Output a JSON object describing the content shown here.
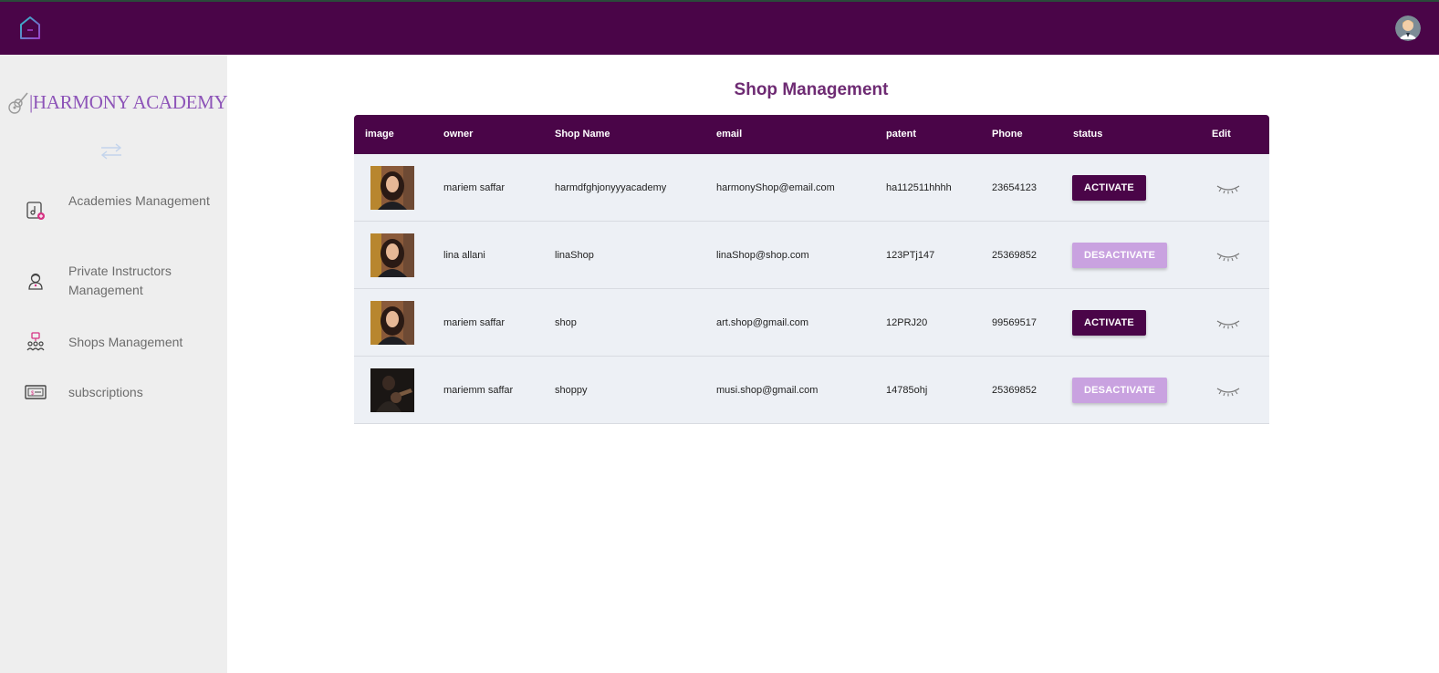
{
  "app": {
    "brand": "|HARMONY ACADEMY"
  },
  "sidebar": {
    "items": [
      {
        "label": "Academies Management",
        "icon": "music-add-icon"
      },
      {
        "label": "Private Instructors Management",
        "icon": "instructor-icon"
      },
      {
        "label": "Shops Management",
        "icon": "shops-icon"
      },
      {
        "label": "subscriptions",
        "icon": "ticket-icon"
      }
    ]
  },
  "page": {
    "title": "Shop Management"
  },
  "table": {
    "headers": [
      "image",
      "owner",
      "Shop Name",
      "email",
      "patent",
      "Phone",
      "status",
      "Edit"
    ],
    "rows": [
      {
        "owner": "mariem saffar",
        "shop_name": "harmdfghjonyyyacademy",
        "email": "harmonyShop@email.com",
        "patent": "ha112511hhhh",
        "phone": "23654123",
        "status_label": "ACTIVATE",
        "status_style": "activate"
      },
      {
        "owner": "lina allani",
        "shop_name": "linaShop",
        "email": "linaShop@shop.com",
        "patent": "123PTj147",
        "phone": "25369852",
        "status_label": "DESACTIVATE",
        "status_style": "desactivate"
      },
      {
        "owner": "mariem saffar",
        "shop_name": "shop",
        "email": "art.shop@gmail.com",
        "patent": "12PRJ20",
        "phone": "99569517",
        "status_label": "ACTIVATE",
        "status_style": "activate"
      },
      {
        "owner": "mariemm saffar",
        "shop_name": "shoppy",
        "email": "musi.shop@gmail.com",
        "patent": "14785ohj",
        "phone": "25369852",
        "status_label": "DESACTIVATE",
        "status_style": "desactivate"
      }
    ]
  },
  "colors": {
    "primary": "#4a0548",
    "accent": "#8d54b8",
    "title": "#6e2b73",
    "desactivate": "#c9a2e0"
  }
}
